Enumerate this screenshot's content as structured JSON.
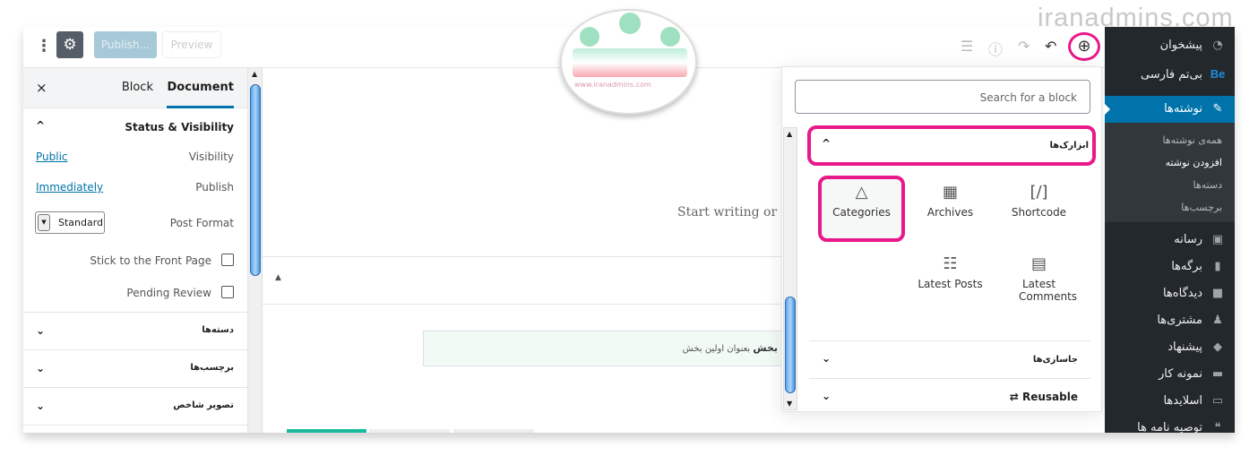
{
  "watermark": {
    "text": "iranadmins.com",
    "logo_text": "www.iranadmins.com"
  },
  "toolbar": {
    "more_icon": "kebab-icon",
    "settings_icon": "gear-icon",
    "publish": "Publish...",
    "preview": "Preview",
    "icons": [
      "list-view-icon",
      "info-icon",
      "redo-icon",
      "undo-icon",
      "add-block-icon"
    ]
  },
  "sidebar": {
    "tabs": [
      "Document",
      "Block"
    ],
    "active_tab": "Document",
    "close": "×",
    "status": {
      "title": "Status & Visibility",
      "visibility_label": "Visibility",
      "visibility_value": "Public",
      "publish_label": "Publish",
      "publish_value": "Immediately",
      "format_label": "Post Format",
      "format_value": "Standard",
      "sticky_label": "Stick to the Front Page",
      "pending_label": "Pending Review"
    },
    "panels": [
      "دسته‌ها",
      "برچسب‌ها",
      "تصویر شاخص"
    ]
  },
  "editor": {
    "placeholder": "Start writing or t",
    "notice_bold": "بخش",
    "notice_text": "بعنوان اولین بخش"
  },
  "inserter": {
    "search_placeholder": "Search for a block",
    "open_panel": "ابزارک‌ها",
    "blocks": [
      {
        "label": "Categories",
        "icon": "categories-icon"
      },
      {
        "label": "Archives",
        "icon": "calendar-icon"
      },
      {
        "label": "Shortcode",
        "icon": "shortcode-icon"
      },
      {
        "label": "Latest Posts",
        "icon": "list-icon"
      },
      {
        "label": "Latest Comments",
        "icon": "comment-icon"
      }
    ],
    "panels": [
      "جاسازی‌ها",
      "Reusable"
    ]
  },
  "admin_menu": {
    "items": [
      {
        "label": "پیشخوان",
        "icon": "dashboard-icon"
      },
      {
        "label": "بی‌تم فارسی",
        "icon": "be-logo-icon"
      },
      {
        "label": "نوشته‌ها",
        "icon": "pin-icon",
        "active": true
      }
    ],
    "submenu": [
      "همه‌ی نوشته‌ها",
      "افزودن نوشته",
      "دسته‌ها",
      "برچسب‌ها"
    ],
    "submenu_current": "افزودن نوشته",
    "items2": [
      {
        "label": "رسانه",
        "icon": "media-icon"
      },
      {
        "label": "برگه‌ها",
        "icon": "pages-icon"
      },
      {
        "label": "دیدگاه‌ها",
        "icon": "comments-icon"
      },
      {
        "label": "مشتری‌ها",
        "icon": "user-icon"
      },
      {
        "label": "پیشنهاد",
        "icon": "clipboard-icon"
      },
      {
        "label": "نمونه کار",
        "icon": "folder-icon"
      },
      {
        "label": "اسلایدها",
        "icon": "slides-icon"
      },
      {
        "label": "توصیه نامه ها",
        "icon": "quote-icon"
      }
    ],
    "accent": "#0073aa"
  }
}
